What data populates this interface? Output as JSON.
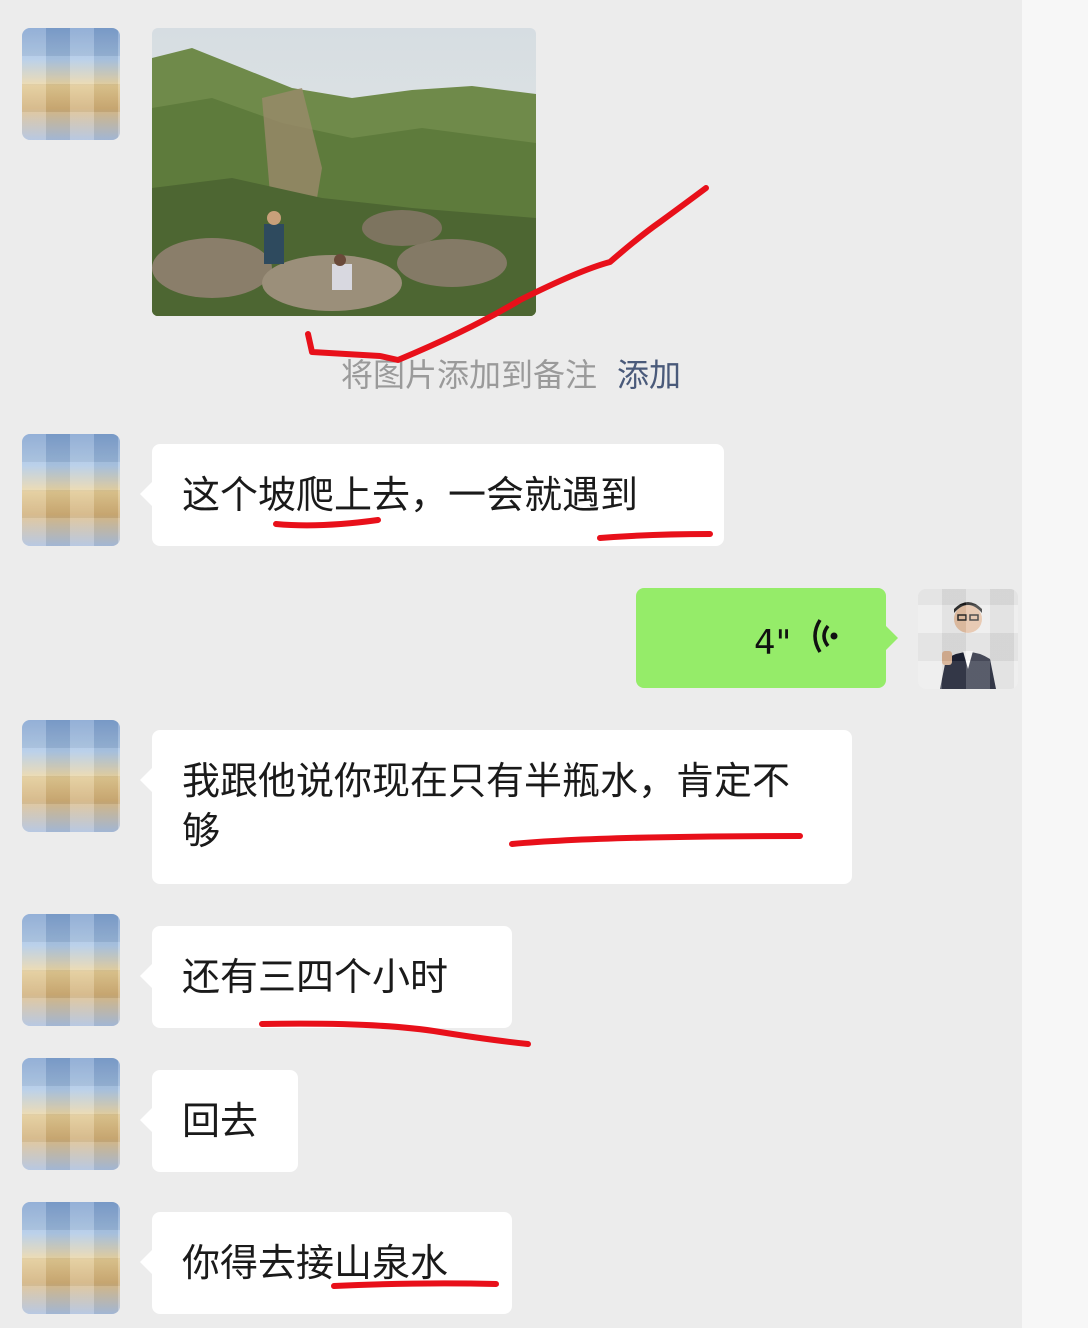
{
  "chat": {
    "photo_note": {
      "text": "将图片添加到备注",
      "action_label": "添加"
    },
    "messages": [
      {
        "text": "这个坡爬上去，一会就遇到"
      },
      {
        "voice_duration": "4\""
      },
      {
        "text": "我跟他说你现在只有半瓶水，肯定不够"
      },
      {
        "text": "还有三四个小时"
      },
      {
        "text": "回去"
      },
      {
        "text": "你得去接山泉水"
      }
    ]
  },
  "colors": {
    "background": "#ececec",
    "incoming_bubble": "#ffffff",
    "outgoing_bubble": "#95ec69",
    "annotation_red": "#e8101a"
  },
  "icons": {
    "voice": "sound-wave-icon"
  }
}
